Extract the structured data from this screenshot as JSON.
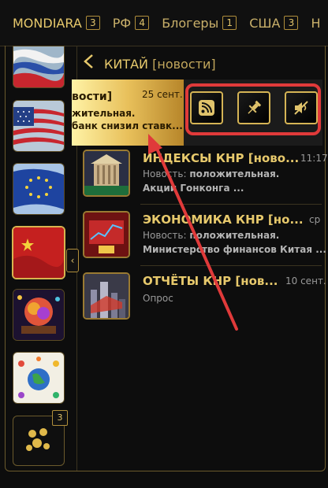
{
  "tabs": [
    {
      "label": "MONDIARA",
      "count": "3"
    },
    {
      "label": "РФ",
      "count": "4"
    },
    {
      "label": "Блогеры",
      "count": "1"
    },
    {
      "label": "США",
      "count": "3"
    },
    {
      "label": "Н",
      "count": ""
    }
  ],
  "header": {
    "title": "КИТАЙ",
    "subtitle": "[новости]"
  },
  "swiped_item": {
    "title": "вости]",
    "date": "25 сент.",
    "line1": "жительная.",
    "line2": "банк снизил ставк..."
  },
  "actions": [
    {
      "name": "rss-icon"
    },
    {
      "name": "pin-icon"
    },
    {
      "name": "mute-icon"
    }
  ],
  "feed": [
    {
      "title": "ИНДЕКСЫ КНР [ново...",
      "date": "11:17",
      "label": "Новость:",
      "value": "положительная.",
      "snippet": "Акции Гонконга ..."
    },
    {
      "title": "ЭКОНОМИКА КНР [но...",
      "date": "ср",
      "label": "Новость:",
      "value": "положительная.",
      "snippet": "Министерство финансов Китая ..."
    },
    {
      "title": "ОТЧЁТЫ КНР [нов...",
      "date": "10 сент.",
      "label": "Опрос",
      "value": "",
      "snippet": ""
    }
  ],
  "bottom_badge": "3",
  "colors": {
    "accent": "#e7c96c",
    "highlight": "#e03a3a",
    "background": "#0d0d0d"
  }
}
